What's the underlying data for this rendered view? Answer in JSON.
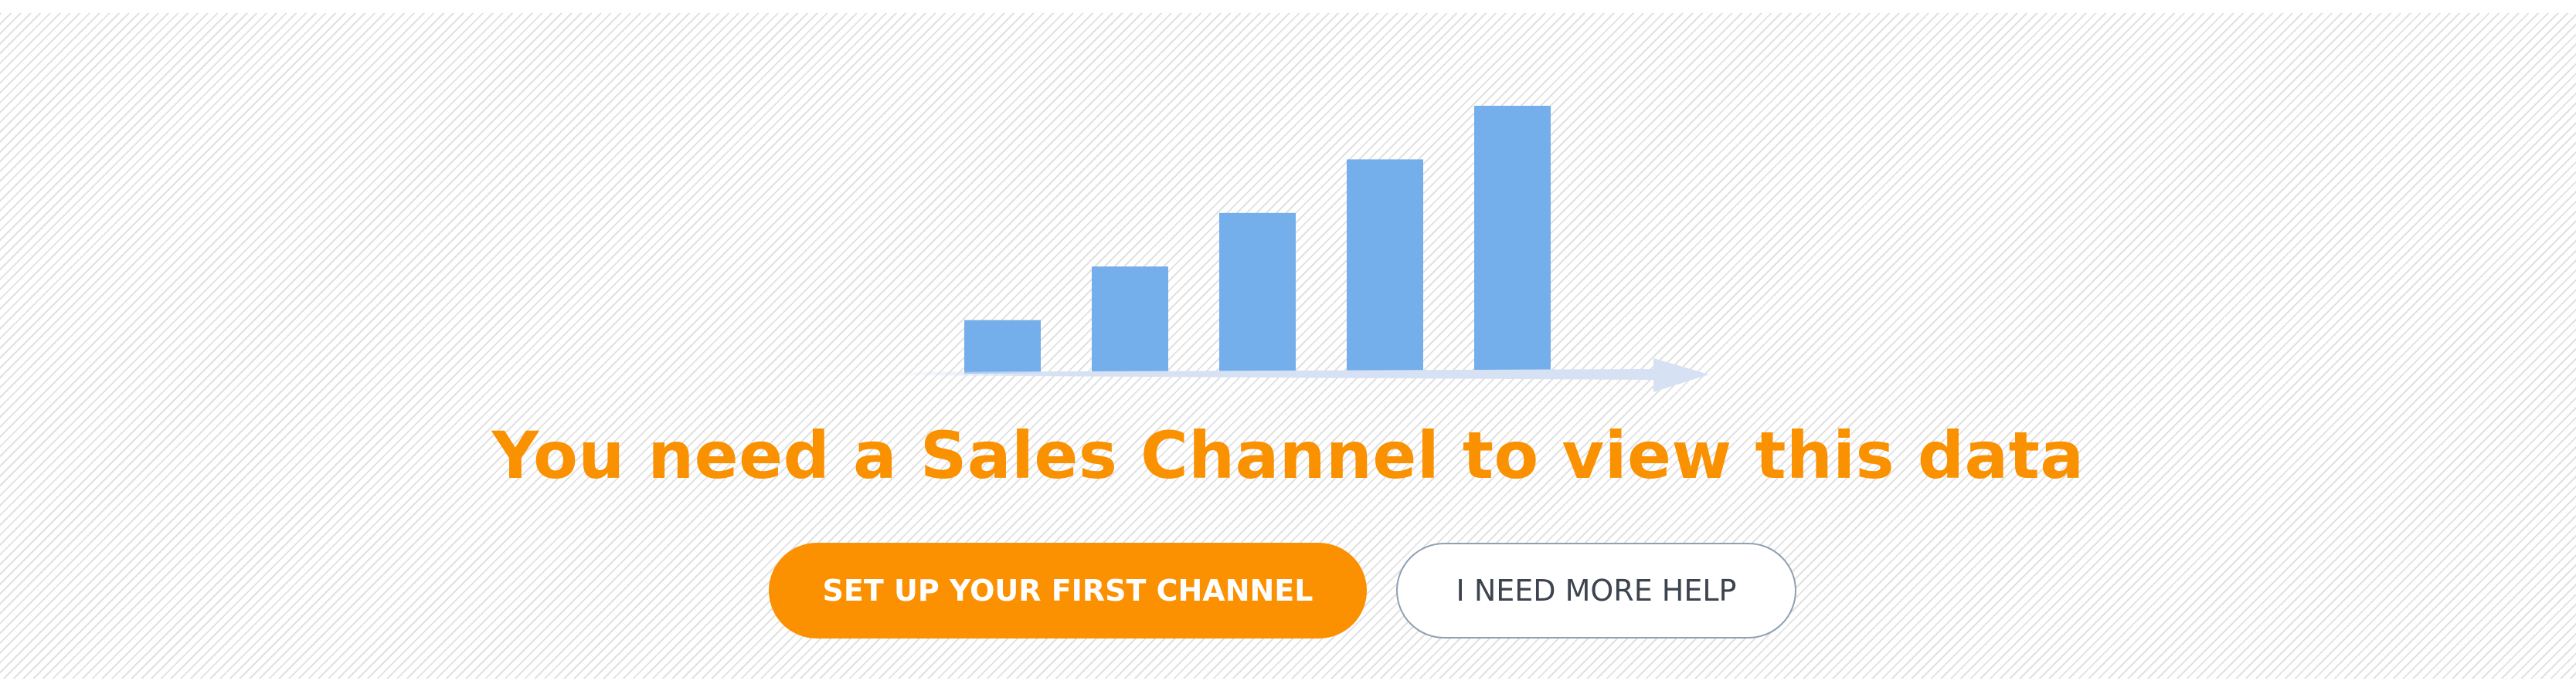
{
  "empty_state": {
    "title": "You need a Sales Channel to view this data",
    "primary_button": "SET UP YOUR FIRST CHANNEL",
    "secondary_button": "I NEED MORE HELP"
  },
  "illustration": {
    "icon": "growth-bar-chart-icon",
    "bar_levels": [
      1,
      2,
      3,
      4,
      5
    ],
    "bar_color": "#74aeeb",
    "arrow_color": "#d7e1f4"
  },
  "colors": {
    "accent": "#f99100",
    "title": "#f99100",
    "secondary_text": "#3d4450",
    "secondary_border": "#8fa0b3"
  }
}
